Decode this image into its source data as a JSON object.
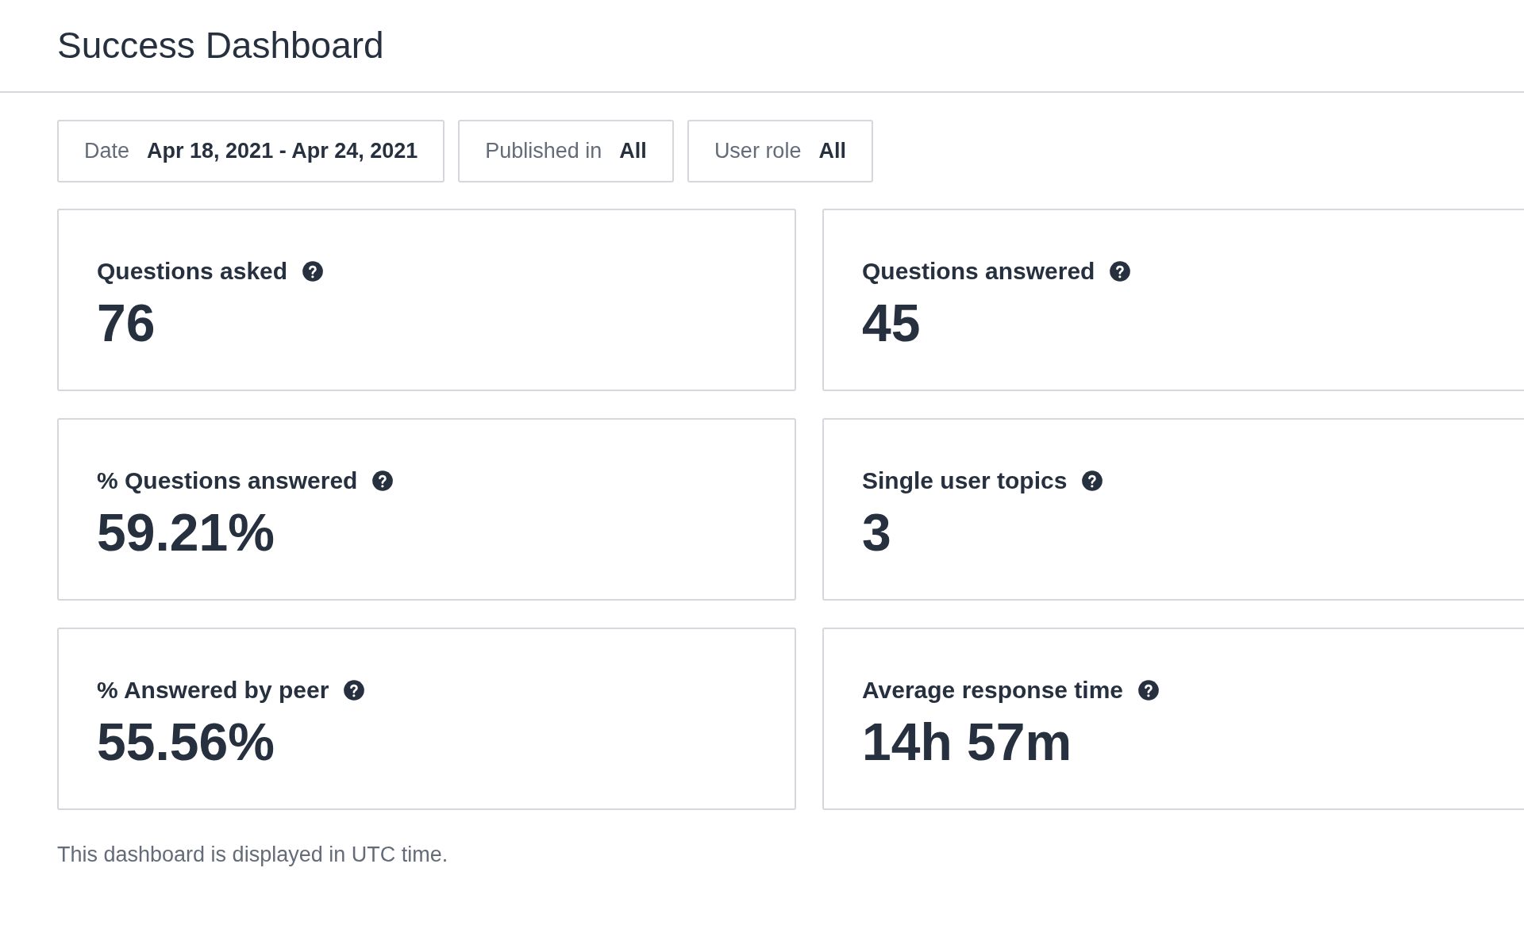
{
  "title": "Success Dashboard",
  "filters": [
    {
      "label": "Date",
      "value": "Apr 18, 2021 - Apr 24, 2021"
    },
    {
      "label": "Published in",
      "value": "All"
    },
    {
      "label": "User role",
      "value": "All"
    }
  ],
  "metrics": [
    {
      "label": "Questions asked",
      "value": "76"
    },
    {
      "label": "Questions answered",
      "value": "45"
    },
    {
      "label": "% Questions answered",
      "value": "59.21%"
    },
    {
      "label": "Single user topics",
      "value": "3"
    },
    {
      "label": "% Answered by peer",
      "value": "55.56%"
    },
    {
      "label": "Average response time",
      "value": "14h 57m"
    }
  ],
  "footer": "This dashboard is displayed in UTC time."
}
